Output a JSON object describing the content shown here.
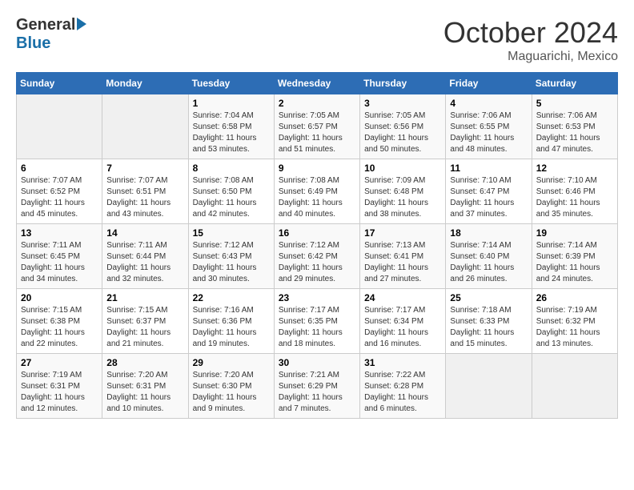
{
  "header": {
    "logo_general": "General",
    "logo_blue": "Blue",
    "month": "October 2024",
    "location": "Maguarichi, Mexico"
  },
  "days_of_week": [
    "Sunday",
    "Monday",
    "Tuesday",
    "Wednesday",
    "Thursday",
    "Friday",
    "Saturday"
  ],
  "weeks": [
    [
      {
        "day": "",
        "empty": true
      },
      {
        "day": "",
        "empty": true
      },
      {
        "day": "1",
        "sunrise": "Sunrise: 7:04 AM",
        "sunset": "Sunset: 6:58 PM",
        "daylight": "Daylight: 11 hours and 53 minutes."
      },
      {
        "day": "2",
        "sunrise": "Sunrise: 7:05 AM",
        "sunset": "Sunset: 6:57 PM",
        "daylight": "Daylight: 11 hours and 51 minutes."
      },
      {
        "day": "3",
        "sunrise": "Sunrise: 7:05 AM",
        "sunset": "Sunset: 6:56 PM",
        "daylight": "Daylight: 11 hours and 50 minutes."
      },
      {
        "day": "4",
        "sunrise": "Sunrise: 7:06 AM",
        "sunset": "Sunset: 6:55 PM",
        "daylight": "Daylight: 11 hours and 48 minutes."
      },
      {
        "day": "5",
        "sunrise": "Sunrise: 7:06 AM",
        "sunset": "Sunset: 6:53 PM",
        "daylight": "Daylight: 11 hours and 47 minutes."
      }
    ],
    [
      {
        "day": "6",
        "sunrise": "Sunrise: 7:07 AM",
        "sunset": "Sunset: 6:52 PM",
        "daylight": "Daylight: 11 hours and 45 minutes."
      },
      {
        "day": "7",
        "sunrise": "Sunrise: 7:07 AM",
        "sunset": "Sunset: 6:51 PM",
        "daylight": "Daylight: 11 hours and 43 minutes."
      },
      {
        "day": "8",
        "sunrise": "Sunrise: 7:08 AM",
        "sunset": "Sunset: 6:50 PM",
        "daylight": "Daylight: 11 hours and 42 minutes."
      },
      {
        "day": "9",
        "sunrise": "Sunrise: 7:08 AM",
        "sunset": "Sunset: 6:49 PM",
        "daylight": "Daylight: 11 hours and 40 minutes."
      },
      {
        "day": "10",
        "sunrise": "Sunrise: 7:09 AM",
        "sunset": "Sunset: 6:48 PM",
        "daylight": "Daylight: 11 hours and 38 minutes."
      },
      {
        "day": "11",
        "sunrise": "Sunrise: 7:10 AM",
        "sunset": "Sunset: 6:47 PM",
        "daylight": "Daylight: 11 hours and 37 minutes."
      },
      {
        "day": "12",
        "sunrise": "Sunrise: 7:10 AM",
        "sunset": "Sunset: 6:46 PM",
        "daylight": "Daylight: 11 hours and 35 minutes."
      }
    ],
    [
      {
        "day": "13",
        "sunrise": "Sunrise: 7:11 AM",
        "sunset": "Sunset: 6:45 PM",
        "daylight": "Daylight: 11 hours and 34 minutes."
      },
      {
        "day": "14",
        "sunrise": "Sunrise: 7:11 AM",
        "sunset": "Sunset: 6:44 PM",
        "daylight": "Daylight: 11 hours and 32 minutes."
      },
      {
        "day": "15",
        "sunrise": "Sunrise: 7:12 AM",
        "sunset": "Sunset: 6:43 PM",
        "daylight": "Daylight: 11 hours and 30 minutes."
      },
      {
        "day": "16",
        "sunrise": "Sunrise: 7:12 AM",
        "sunset": "Sunset: 6:42 PM",
        "daylight": "Daylight: 11 hours and 29 minutes."
      },
      {
        "day": "17",
        "sunrise": "Sunrise: 7:13 AM",
        "sunset": "Sunset: 6:41 PM",
        "daylight": "Daylight: 11 hours and 27 minutes."
      },
      {
        "day": "18",
        "sunrise": "Sunrise: 7:14 AM",
        "sunset": "Sunset: 6:40 PM",
        "daylight": "Daylight: 11 hours and 26 minutes."
      },
      {
        "day": "19",
        "sunrise": "Sunrise: 7:14 AM",
        "sunset": "Sunset: 6:39 PM",
        "daylight": "Daylight: 11 hours and 24 minutes."
      }
    ],
    [
      {
        "day": "20",
        "sunrise": "Sunrise: 7:15 AM",
        "sunset": "Sunset: 6:38 PM",
        "daylight": "Daylight: 11 hours and 22 minutes."
      },
      {
        "day": "21",
        "sunrise": "Sunrise: 7:15 AM",
        "sunset": "Sunset: 6:37 PM",
        "daylight": "Daylight: 11 hours and 21 minutes."
      },
      {
        "day": "22",
        "sunrise": "Sunrise: 7:16 AM",
        "sunset": "Sunset: 6:36 PM",
        "daylight": "Daylight: 11 hours and 19 minutes."
      },
      {
        "day": "23",
        "sunrise": "Sunrise: 7:17 AM",
        "sunset": "Sunset: 6:35 PM",
        "daylight": "Daylight: 11 hours and 18 minutes."
      },
      {
        "day": "24",
        "sunrise": "Sunrise: 7:17 AM",
        "sunset": "Sunset: 6:34 PM",
        "daylight": "Daylight: 11 hours and 16 minutes."
      },
      {
        "day": "25",
        "sunrise": "Sunrise: 7:18 AM",
        "sunset": "Sunset: 6:33 PM",
        "daylight": "Daylight: 11 hours and 15 minutes."
      },
      {
        "day": "26",
        "sunrise": "Sunrise: 7:19 AM",
        "sunset": "Sunset: 6:32 PM",
        "daylight": "Daylight: 11 hours and 13 minutes."
      }
    ],
    [
      {
        "day": "27",
        "sunrise": "Sunrise: 7:19 AM",
        "sunset": "Sunset: 6:31 PM",
        "daylight": "Daylight: 11 hours and 12 minutes."
      },
      {
        "day": "28",
        "sunrise": "Sunrise: 7:20 AM",
        "sunset": "Sunset: 6:31 PM",
        "daylight": "Daylight: 11 hours and 10 minutes."
      },
      {
        "day": "29",
        "sunrise": "Sunrise: 7:20 AM",
        "sunset": "Sunset: 6:30 PM",
        "daylight": "Daylight: 11 hours and 9 minutes."
      },
      {
        "day": "30",
        "sunrise": "Sunrise: 7:21 AM",
        "sunset": "Sunset: 6:29 PM",
        "daylight": "Daylight: 11 hours and 7 minutes."
      },
      {
        "day": "31",
        "sunrise": "Sunrise: 7:22 AM",
        "sunset": "Sunset: 6:28 PM",
        "daylight": "Daylight: 11 hours and 6 minutes."
      },
      {
        "day": "",
        "empty": true
      },
      {
        "day": "",
        "empty": true
      }
    ]
  ]
}
